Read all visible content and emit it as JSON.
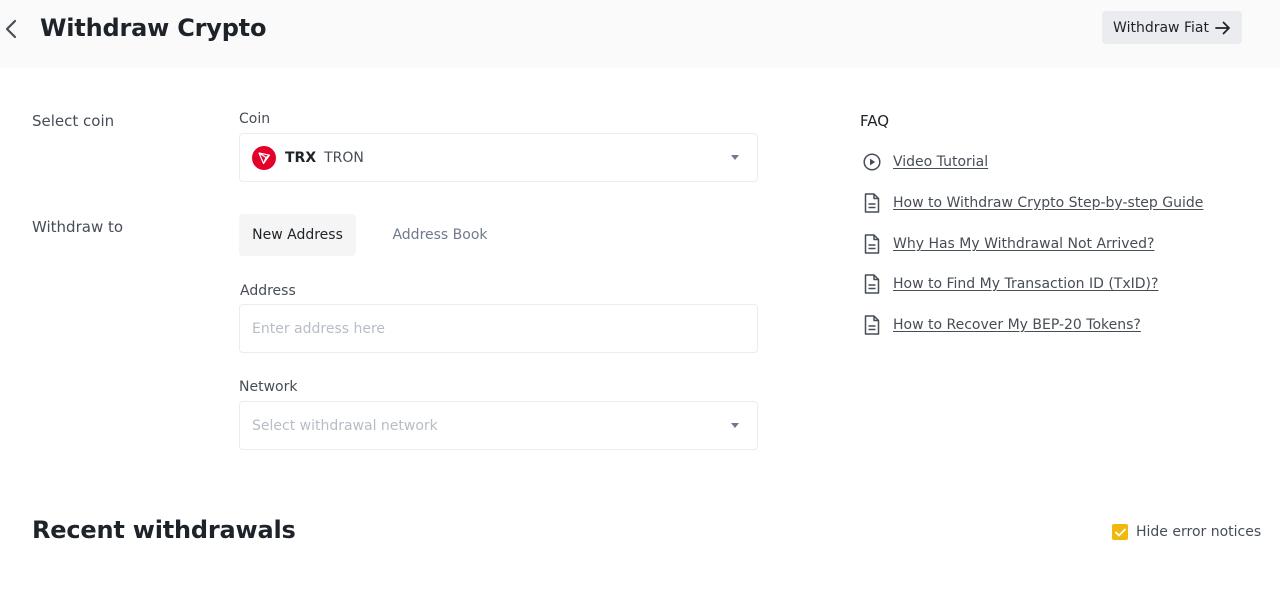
{
  "header": {
    "title": "Withdraw Crypto",
    "fiat_button": "Withdraw Fiat"
  },
  "form": {
    "select_coin_label": "Select coin",
    "coin_field_label": "Coin",
    "coin": {
      "symbol": "TRX",
      "name": "TRON",
      "icon_color": "#e4002b"
    },
    "withdraw_to_label": "Withdraw to",
    "tabs": [
      {
        "label": "New Address",
        "active": true
      },
      {
        "label": "Address Book",
        "active": false
      }
    ],
    "address_label": "Address",
    "address_placeholder": "Enter address here",
    "network_label": "Network",
    "network_placeholder": "Select withdrawal network"
  },
  "faq": {
    "title": "FAQ",
    "items": [
      {
        "label": "Video Tutorial",
        "icon": "play-icon"
      },
      {
        "label": "How to Withdraw Crypto Step-by-step Guide",
        "icon": "document-icon"
      },
      {
        "label": "Why Has My Withdrawal Not Arrived?",
        "icon": "document-icon"
      },
      {
        "label": "How to Find My Transaction ID (TxID)?",
        "icon": "document-icon"
      },
      {
        "label": "How to Recover My BEP-20 Tokens?",
        "icon": "document-icon"
      }
    ]
  },
  "recent": {
    "title": "Recent withdrawals",
    "hide_errors_label": "Hide error notices",
    "hide_errors_checked": true
  },
  "colors": {
    "accent": "#f0b90b",
    "header_bg": "#fafafa",
    "text_primary": "#1e2329",
    "text_secondary": "#474d57"
  }
}
